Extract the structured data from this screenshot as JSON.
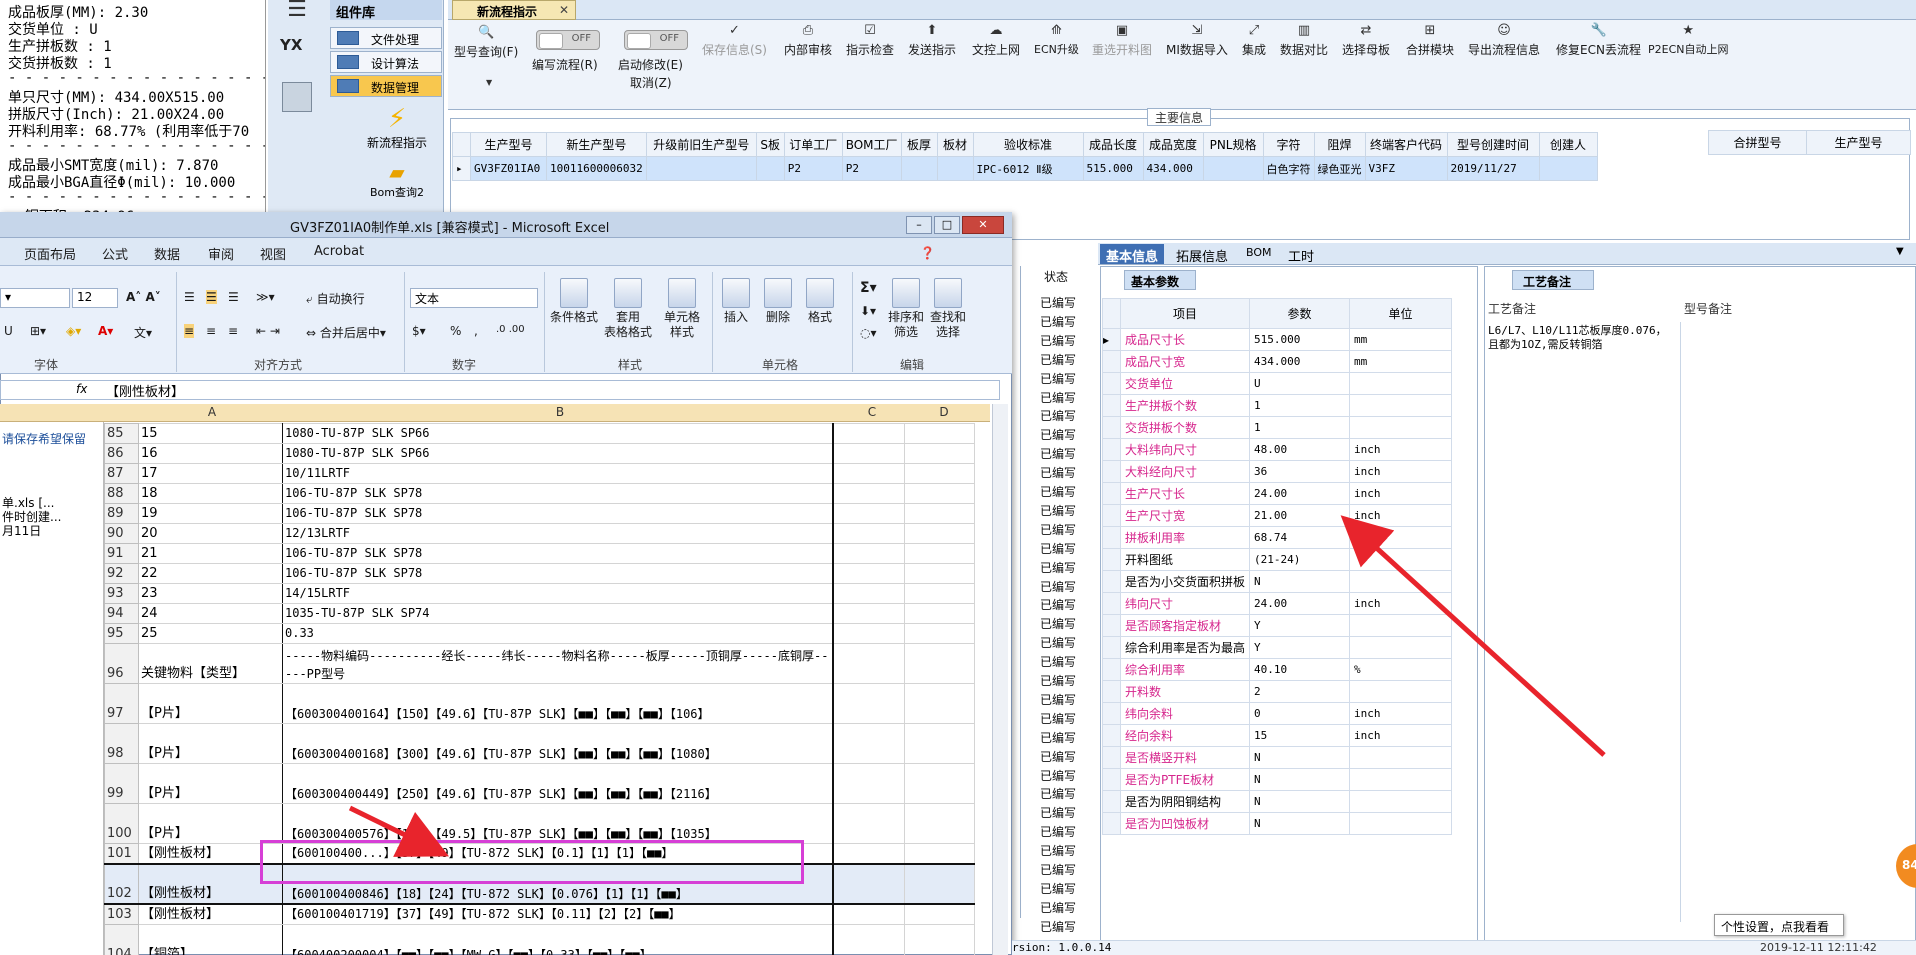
{
  "notepad": {
    "lines": [
      "成品板厚(MM): 2.30",
      "交货单位 : U",
      "生产拼板数 : 1",
      "交货拼板数 : 1",
      "- - - - - - - - - - - - - - - - - - -",
      "单只尺寸(MM): 434.00X515.00",
      "拼版尺寸(Inch): 21.00X24.00",
      "开料利用率: 68.77% (利用率低于70",
      "- - - - - - - - - - - - - - - - - - -",
      "成品最小SMT宽度(mil): 7.870",
      "成品最小BGA直径Φ(mil):  10.000",
      "- - - - - - - - - - - - - - - - - - -",
      "cs铜面积: 234.96"
    ]
  },
  "nav": {
    "title": "组件库",
    "logo": "YX",
    "items": [
      "文件处理",
      "设计算法",
      "数据管理"
    ],
    "big1": "新流程指示",
    "big2": "Bom查询2"
  },
  "apptab": "新流程指示",
  "ribbon": {
    "model_query": "型号查询(F)",
    "write_flow": "编写流程(R)",
    "start_edit": "启动修改(E)",
    "cancel": "取消(Z)",
    "toggle_off": "OFF",
    "buttons": [
      "保存信息(S)",
      "内部审核",
      "指示检查",
      "发送指示",
      "文控上网",
      "ECN升级",
      "重选开料图",
      "MI数据导入",
      "集成",
      "数据对比",
      "选择母板",
      "合拼模块",
      "导出流程信息",
      "修复ECN丢流程",
      "P2ECN自动上网"
    ]
  },
  "main": {
    "header": "主要信息",
    "columns": [
      "生产型号",
      "新生产型号",
      "升级前旧生产型号",
      "S板",
      "订单工厂",
      "BOM工厂",
      "板厚",
      "板材",
      "验收标准",
      "成品长度",
      "成品宽度",
      "PNL规格",
      "字符",
      "阻焊",
      "终端客户代码",
      "型号创建时间",
      "创建人"
    ],
    "row": [
      "GV3FZ01IA0",
      "10011600006032",
      "",
      "",
      "P2",
      "P2",
      "",
      "",
      "IPC-6012 Ⅱ级",
      "515.000",
      "434.000",
      "",
      "白色字符",
      "绿色亚光",
      "V3FZ",
      "2019/11/27",
      ""
    ],
    "merge_columns": [
      "合拼型号",
      "生产型号"
    ]
  },
  "lower": {
    "tabs": [
      "基本信息",
      "拓展信息",
      "BOM",
      "工时"
    ],
    "basic_header": "基本参数",
    "param_columns": [
      "项目",
      "参数",
      "单位"
    ],
    "params": [
      {
        "name": "成品尺寸长",
        "value": "515.000",
        "unit": "mm",
        "pink": true
      },
      {
        "name": "成品尺寸宽",
        "value": "434.000",
        "unit": "mm",
        "pink": true
      },
      {
        "name": "交货单位",
        "value": "U",
        "unit": "",
        "pink": true
      },
      {
        "name": "生产拼板个数",
        "value": "1",
        "unit": "",
        "pink": true
      },
      {
        "name": "交货拼板个数",
        "value": "1",
        "unit": "",
        "pink": true
      },
      {
        "name": "大料纬向尺寸",
        "value": "48.00",
        "unit": "inch",
        "pink": true
      },
      {
        "name": "大料经向尺寸",
        "value": "36",
        "unit": "inch",
        "pink": true
      },
      {
        "name": "生产尺寸长",
        "value": "24.00",
        "unit": "inch",
        "pink": true
      },
      {
        "name": "生产尺寸宽",
        "value": "21.00",
        "unit": "inch",
        "pink": true
      },
      {
        "name": "拼板利用率",
        "value": "68.74",
        "unit": "",
        "pink": true
      },
      {
        "name": "开料图纸",
        "value": "(21-24)",
        "unit": "",
        "pink": false
      },
      {
        "name": "是否为小交货面积拼板",
        "value": "N",
        "unit": "",
        "pink": false
      },
      {
        "name": "纬向尺寸",
        "value": "24.00",
        "unit": "inch",
        "pink": true
      },
      {
        "name": "是否顾客指定板材",
        "value": "Y",
        "unit": "",
        "pink": true
      },
      {
        "name": "综合利用率是否为最高",
        "value": "Y",
        "unit": "",
        "pink": false
      },
      {
        "name": "综合利用率",
        "value": "40.10",
        "unit": "%",
        "pink": true
      },
      {
        "name": "开料数",
        "value": "2",
        "unit": "",
        "pink": true
      },
      {
        "name": "纬向余料",
        "value": "0",
        "unit": "inch",
        "pink": true
      },
      {
        "name": "经向余料",
        "value": "15",
        "unit": "inch",
        "pink": true
      },
      {
        "name": "是否横竖开料",
        "value": "N",
        "unit": "",
        "pink": true
      },
      {
        "name": "是否为PTFE板材",
        "value": "N",
        "unit": "",
        "pink": true
      },
      {
        "name": "是否为阴阳铜结构",
        "value": "N",
        "unit": "",
        "pink": false
      },
      {
        "name": "是否为凹蚀板材",
        "value": "N",
        "unit": "",
        "pink": true
      }
    ],
    "craft_header": "工艺备注",
    "craft_col1": "工艺备注",
    "craft_col2": "型号备注",
    "craft_note": "L6/L7、L10/L11芯板厚度0.076，且都为1OZ,需反转铜箔",
    "status_header": "状态",
    "status_value": "已编写"
  },
  "excel": {
    "title": "GV3FZ01IA0制作单.xls  [兼容模式] - Microsoft Excel",
    "menu": [
      "页面布局",
      "公式",
      "数据",
      "审阅",
      "视图",
      "Acrobat"
    ],
    "font_size": "12",
    "wrap": "自动换行",
    "merge": "合并后居中",
    "number_format": "文本",
    "groups": [
      "字体",
      "对齐方式",
      "数字",
      "样式",
      "单元格",
      "编辑"
    ],
    "style_buttons": [
      "条件格式",
      "套用\n表格格式",
      "单元格\n样式"
    ],
    "cell_buttons": [
      "插入",
      "删除",
      "格式"
    ],
    "edit_buttons": [
      "排序和\n筛选",
      "查找和\n选择"
    ],
    "formula_value": "【刚性板材】",
    "columns": [
      "A",
      "B",
      "C",
      "D"
    ],
    "left_note1": "请保存希望保留",
    "left_note2": "单.xls  [...",
    "left_note3": "件时创建...",
    "left_note4": "月11日",
    "rows": [
      {
        "n": "85",
        "a": "15",
        "b": "1080-TU-87P SLK SP66"
      },
      {
        "n": "86",
        "a": "16",
        "b": "1080-TU-87P SLK SP66"
      },
      {
        "n": "87",
        "a": "17",
        "b": "10/11LRTF"
      },
      {
        "n": "88",
        "a": "18",
        "b": "106-TU-87P SLK SP78"
      },
      {
        "n": "89",
        "a": "19",
        "b": "106-TU-87P SLK SP78"
      },
      {
        "n": "90",
        "a": "20",
        "b": "12/13LRTF"
      },
      {
        "n": "91",
        "a": "21",
        "b": "106-TU-87P SLK SP78"
      },
      {
        "n": "92",
        "a": "22",
        "b": "106-TU-87P SLK SP78"
      },
      {
        "n": "93",
        "a": "23",
        "b": "14/15LRTF"
      },
      {
        "n": "94",
        "a": "24",
        "b": "1035-TU-87P SLK SP74"
      },
      {
        "n": "95",
        "a": "25",
        "b": "0.33"
      }
    ],
    "tall_rows": [
      {
        "n": "96",
        "a": "关键物料【类型】",
        "b": "-----物料编码----------经长-----纬长-----物料名称-----板厚-----顶铜厚-----底铜厚-----PP型号"
      },
      {
        "n": "97",
        "a": "【P片】",
        "b": "【600300400164】【150】【49.6】【TU-87P SLK】【■■】【■■】【■■】【106】"
      },
      {
        "n": "98",
        "a": "【P片】",
        "b": "【600300400168】【300】【49.6】【TU-87P SLK】【■■】【■■】【■■】【1080】"
      },
      {
        "n": "99",
        "a": "【P片】",
        "b": "【600300400449】【250】【49.6】【TU-87P SLK】【■■】【■■】【■■】【2116】"
      },
      {
        "n": "100",
        "a": "【P片】",
        "b": "【600300400576】【150】【49.5】【TU-87P SLK】【■■】【■■】【■■】【1035】"
      }
    ],
    "row101": {
      "n": "101",
      "a": "【刚性板材】",
      "b": "【600100400...】【37】【49】【TU-872 SLK】【0.1】【1】【1】【■■】"
    },
    "row102": {
      "n": "102",
      "a": "【刚性板材】",
      "b": "【600100400846】【18】【24】【TU-872 SLK】【0.076】【1】【1】【■■】"
    },
    "row103": {
      "n": "103",
      "a": "【刚性板材】",
      "b": "【600100401719】【37】【49】【TU-872 SLK】【0.11】【2】【2】【■■】"
    },
    "row104": {
      "n": "104",
      "a": "【铜箔】",
      "b": "【600400200004】【■■】【■■】【MW-G】【■■】【0.33】【■■】【■■】"
    },
    "row105": {
      "n": "105",
      "a": "",
      "b": ""
    }
  },
  "tooltip": "个性设置，点我看看",
  "orange_badge": "84",
  "version": "rsion: 1.0.0.14",
  "clock": "2019-12-11 12:11:42",
  "colors": {
    "pink": "#d6268d",
    "arrow_red": "#e8242c",
    "box_purple": "#d63fd6",
    "nav_sel": "#f8c74e"
  }
}
